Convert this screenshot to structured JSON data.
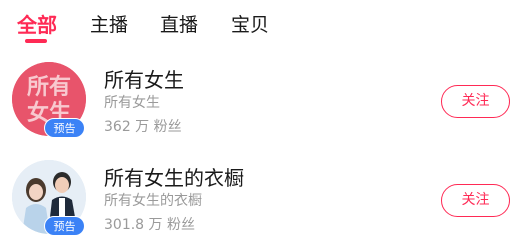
{
  "tabs": [
    {
      "label": "全部",
      "active": true
    },
    {
      "label": "主播",
      "active": false
    },
    {
      "label": "直播",
      "active": false
    },
    {
      "label": "宝贝",
      "active": false
    }
  ],
  "results": [
    {
      "title": "所有女生",
      "subtitle": "所有女生",
      "fans": "362 万 粉丝",
      "badge": "预告",
      "avatar_text_line1": "所有",
      "avatar_text_line2": "女生",
      "follow_label": "关注"
    },
    {
      "title": "所有女生的衣橱",
      "subtitle": "所有女生的衣橱",
      "fans": "301.8 万 粉丝",
      "badge": "预告",
      "follow_label": "关注"
    }
  ],
  "colors": {
    "accent": "#ff2a55",
    "badge": "#3b82f6",
    "muted_text": "#9a9a9a"
  }
}
